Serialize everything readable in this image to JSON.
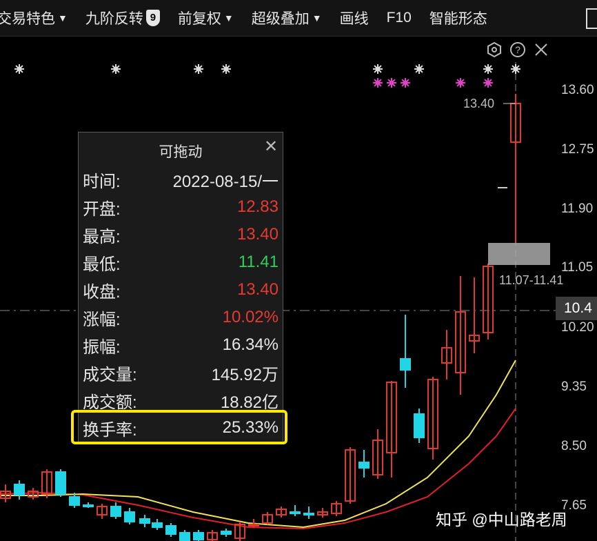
{
  "toolbar": {
    "items": [
      "交易特色",
      "九阶反转",
      "前复权",
      "超级叠加",
      "画线",
      "F10",
      "智能形态"
    ],
    "badge": "9"
  },
  "icons": {
    "toolbar_caret": "caret-down-icon",
    "tools": [
      "hexagon-settings-icon",
      "help-icon",
      "close-icon"
    ]
  },
  "chart_labels": {
    "high_marker": "13.40",
    "range": "11.07-11.41",
    "current_price": "10.4"
  },
  "price_axis": [
    "13.60",
    "12.75",
    "11.90",
    "11.05",
    "10.20",
    "9.35",
    "8.50",
    "7.65"
  ],
  "popup": {
    "title": "可拖动",
    "rows": [
      {
        "label": "时间:",
        "value": "2022-08-15/一",
        "color": "#e6e6e6"
      },
      {
        "label": "开盘:",
        "value": "12.83",
        "color": "#e83a33"
      },
      {
        "label": "最高:",
        "value": "13.40",
        "color": "#e83a33"
      },
      {
        "label": "最低:",
        "value": "11.41",
        "color": "#2bd15a"
      },
      {
        "label": "收盘:",
        "value": "13.40",
        "color": "#e83a33"
      },
      {
        "label": "涨幅:",
        "value": "10.02%",
        "color": "#e83a33"
      },
      {
        "label": "振幅:",
        "value": "16.34%",
        "color": "#e6e6e6"
      },
      {
        "label": "成交量:",
        "value": "145.92万",
        "color": "#e6e6e6"
      },
      {
        "label": "成交额:",
        "value": "18.82亿",
        "color": "#e6e6e6"
      },
      {
        "label": "换手率:",
        "value": "25.33%",
        "color": "#e6e6e6"
      }
    ]
  },
  "watermark": "知乎 @中山路老周",
  "colors": {
    "up": "#e0392f",
    "down": "#21d4e6",
    "highlight": "#ffe800",
    "ma_fast": "#f2e25a",
    "ma_slow": "#e0202a",
    "star_white": "#dcdcdc",
    "star_pink": "#e040c8"
  }
}
